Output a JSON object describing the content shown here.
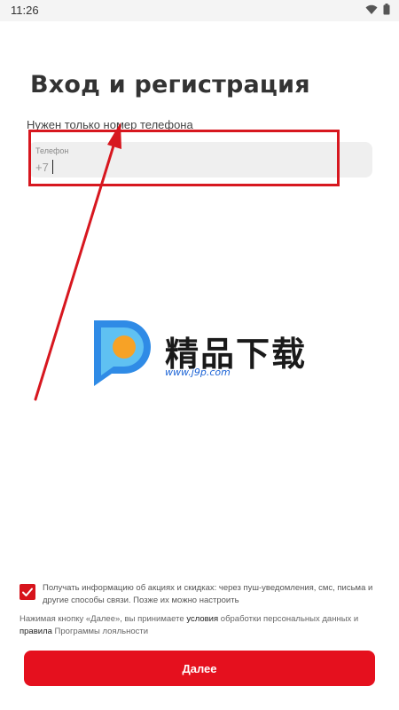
{
  "status_bar": {
    "time": "11:26",
    "icons": [
      "wifi-icon",
      "battery-icon"
    ]
  },
  "login": {
    "title": "Вход и регистрация",
    "subtitle": "Нужен только номер телефона",
    "phone_field": {
      "label": "Телефон",
      "value": "+7"
    }
  },
  "watermark": {
    "brand_text": "精品下载",
    "url_text": "www.j9p.com"
  },
  "consent": {
    "checked": true,
    "text": "Получать информацию об акциях и скидках: через пуш-уведомления, смс, письма и другие способы связи. Позже их можно настроить"
  },
  "terms": {
    "prefix": "Нажимая кнопку «Далее», вы принимаете ",
    "link1": "условия",
    "middle": " обработки персональных данных и ",
    "link2": "правила",
    "suffix": " Программы лояльности"
  },
  "actions": {
    "next_label": "Далее"
  },
  "colors": {
    "accent": "#e5101e",
    "annotation_red": "#d7171f",
    "field_bg": "#efefef"
  }
}
